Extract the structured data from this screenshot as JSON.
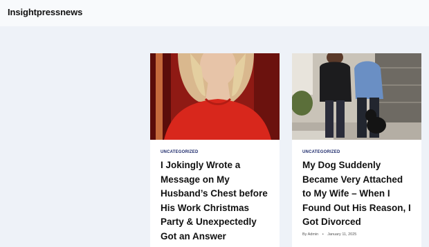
{
  "site": {
    "title": "Insightpressnews"
  },
  "posts": [
    {
      "category": "UNCATEGORIZED",
      "title": "I Jokingly Wrote a Message on My Husband’s Chest before His Work Christmas Party & Unexpectedly Got an Answer",
      "author": "",
      "date": "",
      "image_alt": "woman-in-red-sweater-photo"
    },
    {
      "category": "UNCATEGORIZED",
      "title": "My Dog Suddenly Became Very Attached to My Wife – When I Found Out His Reason, I Got Divorced",
      "author": "By Admin",
      "date": "January 11, 2025",
      "image_alt": "couple-with-dog-photo"
    }
  ]
}
